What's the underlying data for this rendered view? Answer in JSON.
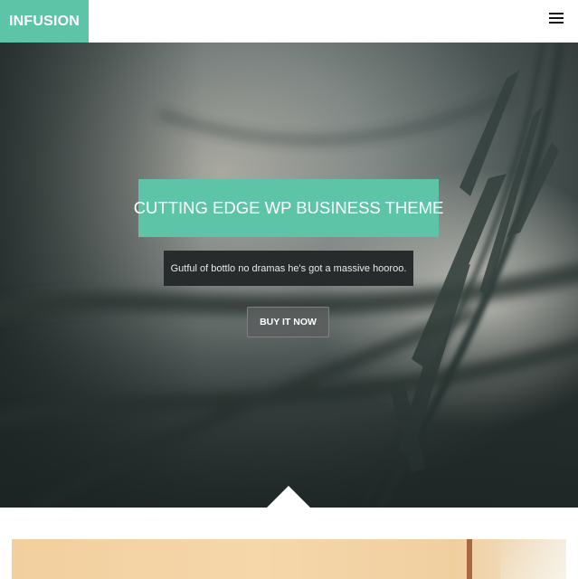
{
  "header": {
    "logo_text": "INFUSION",
    "menu_icon": "hamburger-menu-icon",
    "accent_color": "#5ec4a7"
  },
  "hero": {
    "title": "CUTTING EDGE WP BUSINESS THEME",
    "subtitle": "Gutful of bottlo no dramas he's got a massive hooroo.",
    "button_label": "BUY IT NOW"
  }
}
